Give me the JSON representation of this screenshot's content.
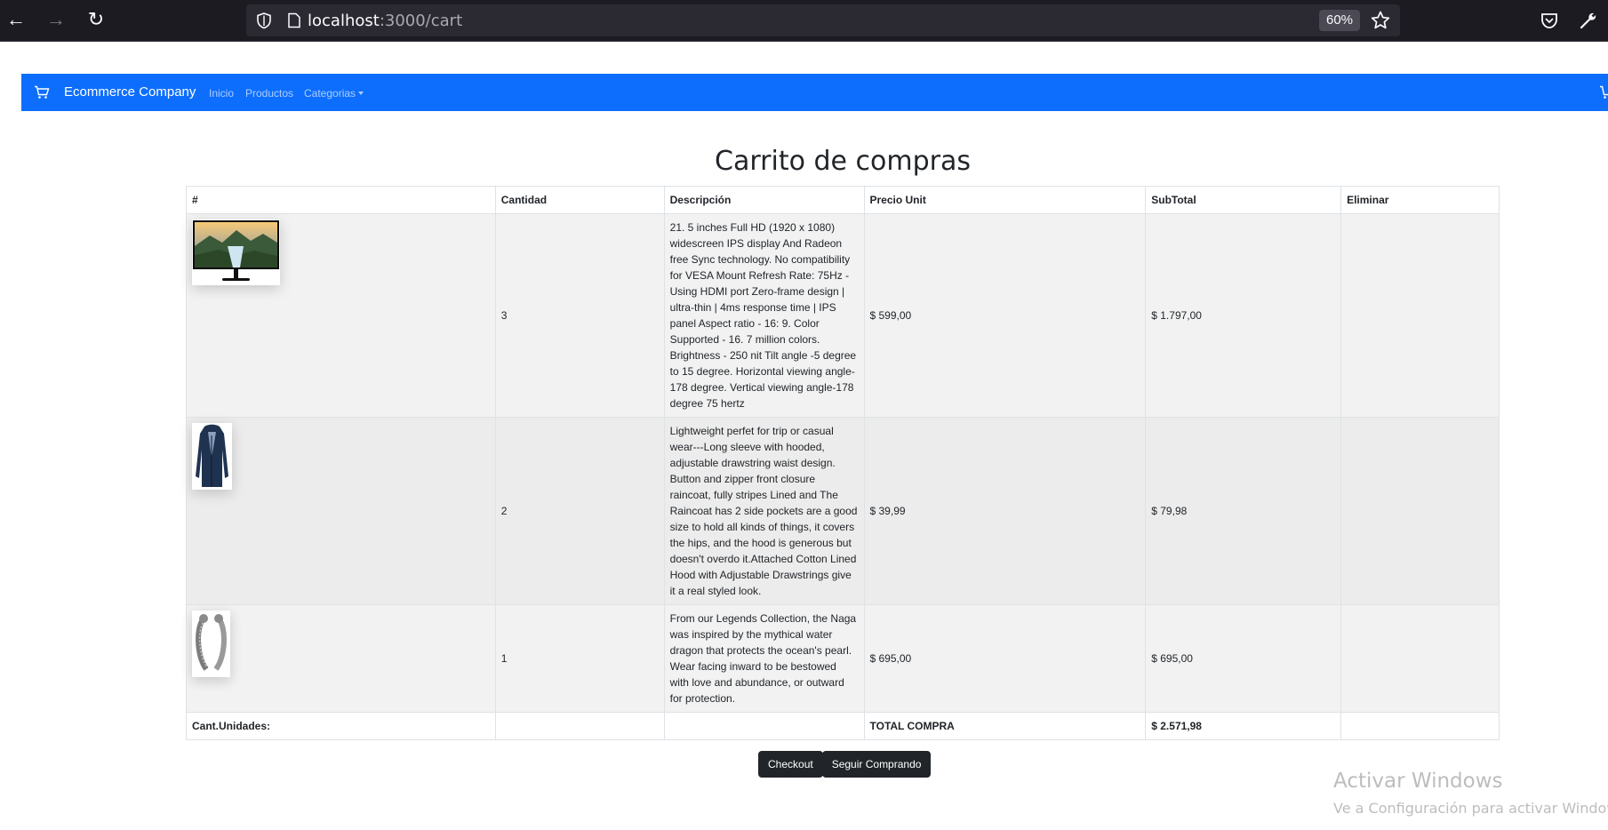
{
  "browser": {
    "url_host": "localhost",
    "url_path": ":3000/cart",
    "zoom": "60%"
  },
  "navbar": {
    "brand": "Ecommerce Company",
    "links": [
      "Inicio",
      "Productos",
      "Categorias"
    ],
    "accent_color": "#0d6efd"
  },
  "page": {
    "title": "Carrito de compras"
  },
  "table": {
    "headers": [
      "#",
      "Cantidad",
      "Descripción",
      "Precio Unit",
      "SubTotal",
      "Eliminar"
    ],
    "rows": [
      {
        "image": "monitor-image",
        "quantity": "3",
        "description": "21. 5 inches Full HD (1920 x 1080) widescreen IPS display And Radeon free Sync technology. No compatibility for VESA Mount Refresh Rate: 75Hz - Using HDMI port Zero-frame design | ultra-thin | 4ms response time | IPS panel Aspect ratio - 16: 9. Color Supported - 16. 7 million colors. Brightness - 250 nit Tilt angle -5 degree to 15 degree. Horizontal viewing angle-178 degree. Vertical viewing angle-178 degree 75 hertz",
        "unit_price": "$ 599,00",
        "subtotal": "$ 1.797,00"
      },
      {
        "image": "raincoat-image",
        "quantity": "2",
        "description": "Lightweight perfet for trip or casual wear---Long sleeve with hooded, adjustable drawstring waist design. Button and zipper front closure raincoat, fully stripes Lined and The Raincoat has 2 side pockets are a good size to hold all kinds of things, it covers the hips, and the hood is generous but doesn't overdo it.Attached Cotton Lined Hood with Adjustable Drawstrings give it a real styled look.",
        "unit_price": "$ 39,99",
        "subtotal": "$ 79,98"
      },
      {
        "image": "bracelet-image",
        "quantity": "1",
        "description": "From our Legends Collection, the Naga was inspired by the mythical water dragon that protects the ocean's pearl. Wear facing inward to be bestowed with love and abundance, or outward for protection.",
        "unit_price": "$ 695,00",
        "subtotal": "$ 695,00"
      }
    ],
    "footer": {
      "units_label": "Cant.Unidades:",
      "total_label": "TOTAL COMPRA",
      "total_value": "$ 2.571,98"
    }
  },
  "actions": {
    "checkout": "Checkout",
    "continue": "Seguir Comprando"
  },
  "watermark": {
    "line1": "Activar Windows",
    "line2": "Ve a Configuración para activar Windows."
  }
}
